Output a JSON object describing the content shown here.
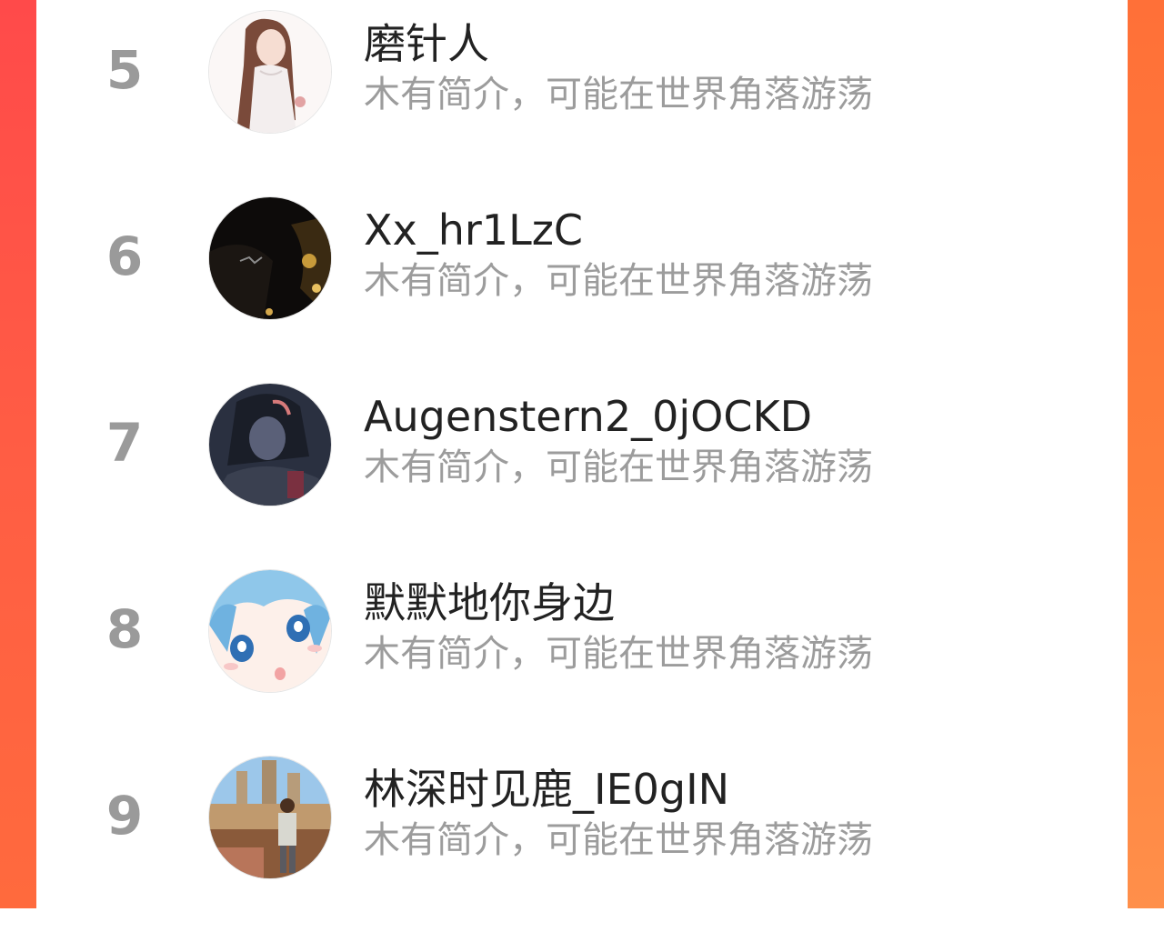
{
  "theme": {
    "accent_left": "#ff4a4a",
    "accent_right": "#ff7f3c",
    "rank_color": "#9a9a9a",
    "name_color": "#222222",
    "bio_color": "#9c9c9c"
  },
  "ranking": {
    "entries": [
      {
        "rank": "5",
        "name": "磨针人",
        "bio": "木有简介，可能在世界角落游荡",
        "avatar_icon": "anime-girl-avatar"
      },
      {
        "rank": "6",
        "name": "Xx_hr1LzC",
        "bio": "木有简介，可能在世界角落游荡",
        "avatar_icon": "dark-photo-avatar"
      },
      {
        "rank": "7",
        "name": "Augenstern2_0jOCKD",
        "bio": "木有简介，可能在世界角落游荡",
        "avatar_icon": "dark-warrior-avatar"
      },
      {
        "rank": "8",
        "name": "默默地你身边",
        "bio": "木有简介，可能在世界角落游荡",
        "avatar_icon": "anime-face-avatar"
      },
      {
        "rank": "9",
        "name": "林深时见鹿_IE0gIN",
        "bio": "木有简介，可能在世界角落游荡",
        "avatar_icon": "travel-photo-avatar"
      }
    ]
  }
}
